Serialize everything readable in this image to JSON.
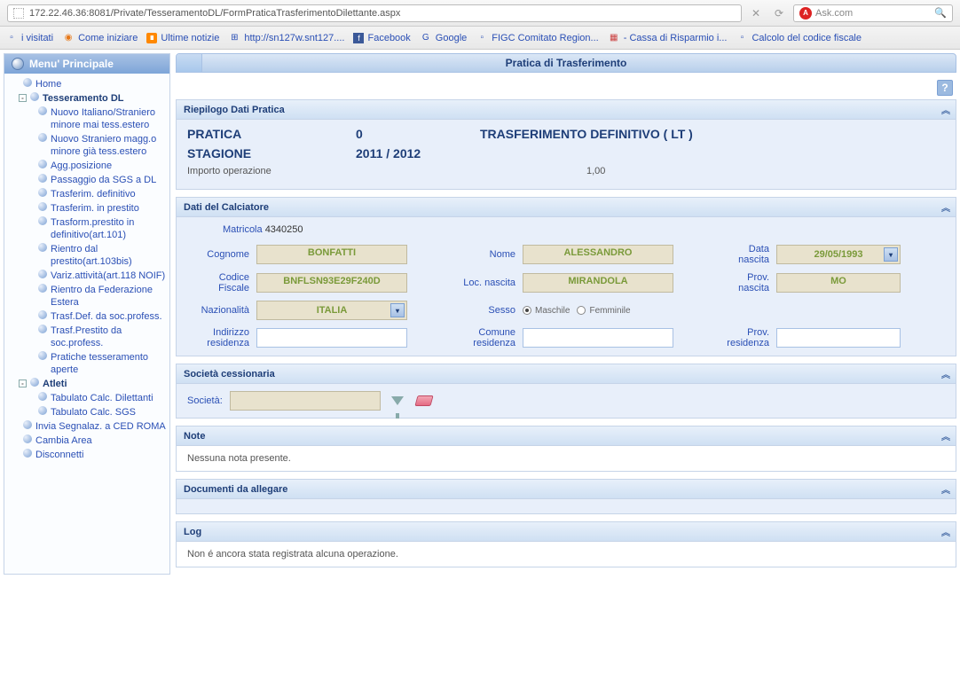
{
  "browser": {
    "url": "172.22.46.36:8081/Private/TesseramentoDL/FormPraticaTrasferimentoDilettante.aspx",
    "search_placeholder": "Ask.com"
  },
  "bookmarks": [
    {
      "label": "i visitati"
    },
    {
      "label": "Come iniziare"
    },
    {
      "label": "Ultime notizie"
    },
    {
      "label": "http://sn127w.snt127...."
    },
    {
      "label": "Facebook"
    },
    {
      "label": "Google"
    },
    {
      "label": "FIGC Comitato Region..."
    },
    {
      "label": " - Cassa di Risparmio i..."
    },
    {
      "label": "Calcolo del codice fiscale"
    }
  ],
  "sidebar": {
    "title": "Menu' Principale",
    "items": [
      {
        "lvl": 0,
        "label": "Home",
        "ico": "ball"
      },
      {
        "lvl": 1,
        "label": "Tesseramento DL",
        "exp": "-"
      },
      {
        "lvl": 2,
        "label": "Nuovo Italiano/Straniero minore mai tess.estero"
      },
      {
        "lvl": 2,
        "label": "Nuovo Straniero magg.o minore già tess.estero"
      },
      {
        "lvl": 2,
        "label": "Agg.posizione"
      },
      {
        "lvl": 2,
        "label": "Passaggio da SGS a DL"
      },
      {
        "lvl": 2,
        "label": "Trasferim. definitivo"
      },
      {
        "lvl": 2,
        "label": "Trasferim. in prestito"
      },
      {
        "lvl": 2,
        "label": "Trasform.prestito in definitivo(art.101)"
      },
      {
        "lvl": 2,
        "label": "Rientro dal prestito(art.103bis)"
      },
      {
        "lvl": 2,
        "label": "Variz.attività(art.118 NOIF)"
      },
      {
        "lvl": 2,
        "label": "Rientro da Federazione Estera"
      },
      {
        "lvl": 2,
        "label": "Trasf.Def. da soc.profess."
      },
      {
        "lvl": 2,
        "label": "Trasf.Prestito da soc.profess."
      },
      {
        "lvl": 2,
        "label": "Pratiche tesseramento aperte"
      },
      {
        "lvl": 1,
        "label": "Atleti",
        "exp": "-"
      },
      {
        "lvl": 2,
        "label": "Tabulato Calc. Dilettanti"
      },
      {
        "lvl": 2,
        "label": "Tabulato Calc. SGS"
      },
      {
        "lvl": 0,
        "label": "Invia Segnalaz. a CED ROMA",
        "ico": "ball"
      },
      {
        "lvl": 0,
        "label": "Cambia Area",
        "ico": "ball"
      },
      {
        "lvl": 0,
        "label": "Disconnetti",
        "ico": "ball"
      }
    ]
  },
  "main": {
    "title": "Pratica di Trasferimento",
    "panels": {
      "riepilogo": {
        "title": "Riepilogo Dati Pratica",
        "pratica_label": "PRATICA",
        "pratica_value": "0",
        "tipo": "TRASFERIMENTO DEFINITIVO  ( LT )",
        "stagione_label": "STAGIONE",
        "stagione_value": "2011 / 2012",
        "importo_label": "Importo operazione",
        "importo_value": "1,00"
      },
      "calciatore": {
        "title": "Dati del Calciatore",
        "matricola_label": "Matricola",
        "matricola_value": "4340250",
        "cognome_label": "Cognome",
        "cognome_value": "BONFATTI",
        "nome_label": "Nome",
        "nome_value": "ALESSANDRO",
        "cf_label": "Codice Fiscale",
        "cf_value": "BNFLSN93E29F240D",
        "locnasc_label": "Loc. nascita",
        "locnasc_value": "MIRANDOLA",
        "dnasc_label": "Data nascita",
        "dnasc_value": "29/05/1993",
        "provnasc_label": "Prov. nascita",
        "provnasc_value": "MO",
        "naz_label": "Nazionalità",
        "naz_value": "ITALIA",
        "sesso_label": "Sesso",
        "sesso_m": "Maschile",
        "sesso_f": "Femminile",
        "indres_label": "Indirizzo residenza",
        "comres_label": "Comune residenza",
        "provres_label": "Prov. residenza"
      },
      "societa": {
        "title": "Società cessionaria",
        "label": "Società:"
      },
      "note": {
        "title": "Note",
        "body": "Nessuna nota presente."
      },
      "documenti": {
        "title": "Documenti da allegare"
      },
      "log": {
        "title": "Log",
        "body": "Non é ancora stata registrata alcuna operazione."
      }
    }
  }
}
